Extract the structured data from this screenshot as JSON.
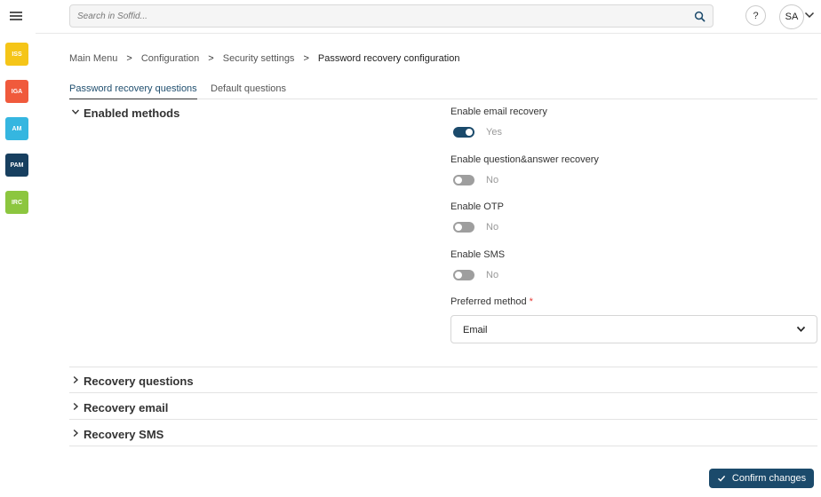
{
  "header": {
    "search_placeholder": "Search in Soffid...",
    "help_label": "?",
    "user_initials": "SA"
  },
  "modules": [
    {
      "label": "ISS",
      "color": "#f5c518"
    },
    {
      "label": "IGA",
      "color": "#f05a3c"
    },
    {
      "label": "AM",
      "color": "#35b6e0"
    },
    {
      "label": "PAM",
      "color": "#173f5f"
    },
    {
      "label": "IRC",
      "color": "#8cc63f"
    }
  ],
  "breadcrumb": {
    "items": [
      "Main Menu",
      "Configuration",
      "Security settings",
      "Password recovery configuration"
    ],
    "separator": ">"
  },
  "tabs": [
    {
      "label": "Password recovery questions",
      "active": true
    },
    {
      "label": "Default questions",
      "active": false
    }
  ],
  "sections": {
    "enabled_methods": {
      "title": "Enabled methods",
      "fields": [
        {
          "label": "Enable email recovery",
          "state": "Yes",
          "on": true
        },
        {
          "label": "Enable question&answer recovery",
          "state": "No",
          "on": false
        },
        {
          "label": "Enable OTP",
          "state": "No",
          "on": false
        },
        {
          "label": "Enable SMS",
          "state": "No",
          "on": false
        }
      ],
      "preferred_method": {
        "label": "Preferred method",
        "required_mark": "*",
        "value": "Email"
      }
    },
    "recovery_questions": {
      "title": "Recovery questions"
    },
    "recovery_email": {
      "title": "Recovery email"
    },
    "recovery_sms": {
      "title": "Recovery SMS"
    }
  },
  "actions": {
    "confirm_label": "Confirm changes"
  }
}
